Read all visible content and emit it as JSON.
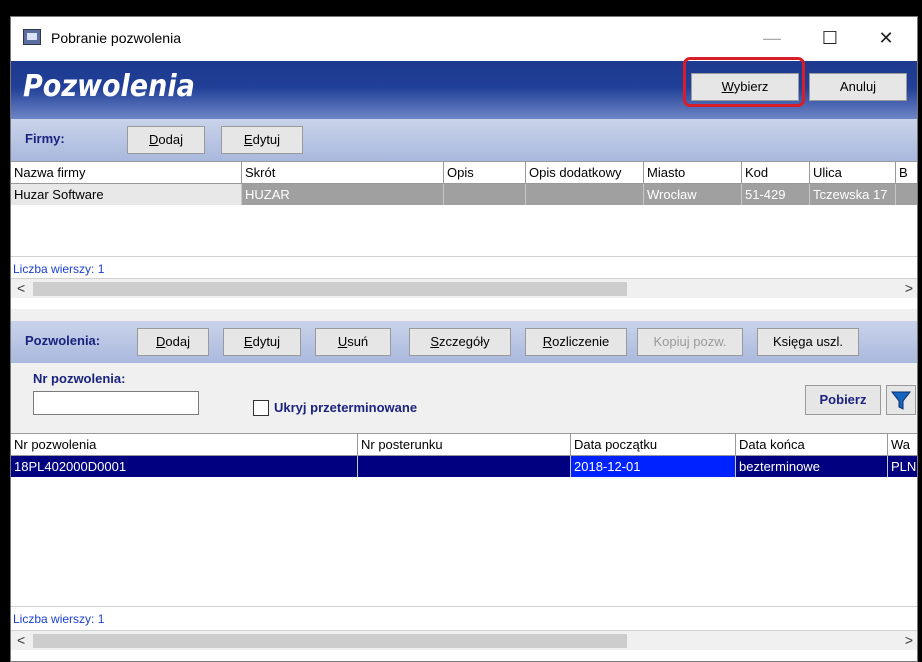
{
  "window": {
    "title": "Pobranie pozwolenia",
    "controls": {
      "minimize": "—",
      "maximize": "☐",
      "close": "✕"
    }
  },
  "header": {
    "title": "Pozwolenia",
    "select_label": "Wybierz",
    "cancel_label": "Anuluj"
  },
  "firms": {
    "label": "Firmy:",
    "add_label": "Dodaj",
    "edit_label": "Edytuj",
    "columns": [
      "Nazwa firmy",
      "Skrót",
      "Opis",
      "Opis dodatkowy",
      "Miasto",
      "Kod",
      "Ulica",
      "B"
    ],
    "rows": [
      [
        "Huzar Software",
        "HUZAR",
        "",
        "",
        "Wrocław",
        "51-429",
        "Tczewska 17",
        ""
      ]
    ],
    "row_count_label": "Liczba wierszy: 1"
  },
  "permits": {
    "label": "Pozwolenia:",
    "add_label": "Dodaj",
    "edit_label": "Edytuj",
    "delete_label": "Usuń",
    "details_label": "Szczegóły",
    "settlement_label": "Rozliczenie",
    "copy_label": "Kopiuj pozw.",
    "ledger_label": "Księga uszl.",
    "filter_label": "Nr pozwolenia:",
    "filter_value": "",
    "hide_expired_label": "Ukryj przeterminowane",
    "hide_expired_checked": false,
    "fetch_label": "Pobierz",
    "columns": [
      "Nr pozwolenia",
      "Nr posterunku",
      "Data początku",
      "Data końca",
      "Wa"
    ],
    "rows": [
      [
        "18PL402000D0001",
        "",
        "2018-12-01",
        "bezterminowe",
        "PLN"
      ]
    ],
    "row_count_label": "Liczba wierszy: 1"
  },
  "colors": {
    "banner": "#203f96",
    "selected_row": "#000080",
    "selected_cell": "#0022ff",
    "highlight": "#d81e2a",
    "section_label": "#1a237e"
  },
  "icons": {
    "filter": "funnel-icon",
    "app": "app-window-icon"
  }
}
